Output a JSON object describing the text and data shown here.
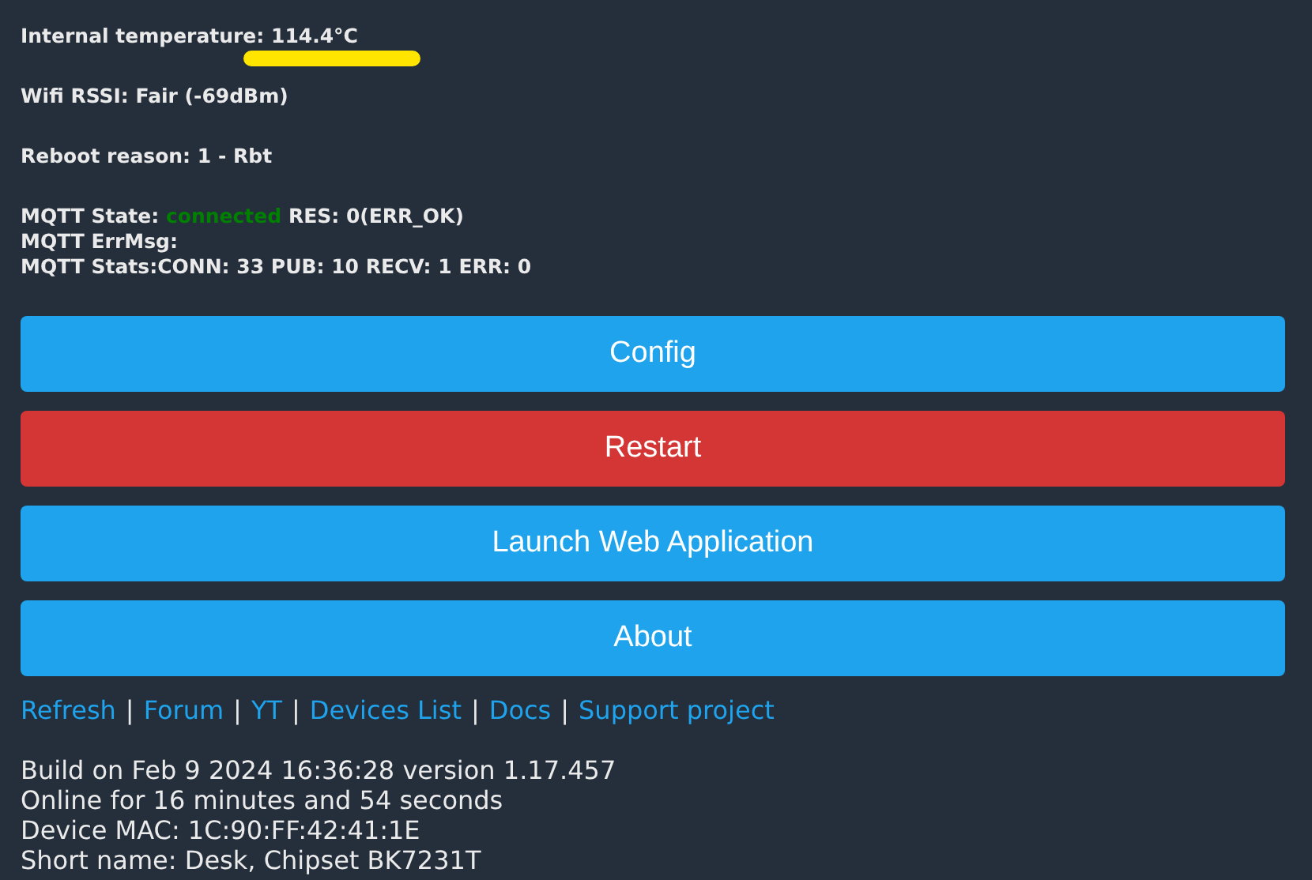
{
  "status": {
    "temperature": {
      "text": "Internal temperature: 114.4°C",
      "underlined": true
    },
    "wifi": "Wifi RSSI: Fair (-69dBm)",
    "reboot": "Reboot reason: 1 - Rbt",
    "mqtt": {
      "state_label": "MQTT State:",
      "state": "connected",
      "connected": true,
      "result": "RES: 0(ERR_OK)",
      "errmsg": "MQTT ErrMsg:",
      "stats": "MQTT Stats:CONN: 33 PUB: 10 RECV: 1 ERR: 0"
    }
  },
  "buttons": [
    {
      "label": "Config",
      "kind": "normal"
    },
    {
      "label": "Restart",
      "kind": "danger"
    },
    {
      "label": "Launch Web Application",
      "kind": "normal"
    },
    {
      "label": "About",
      "kind": "normal"
    }
  ],
  "links": [
    {
      "label": "Refresh",
      "separator": "|"
    },
    {
      "label": "Forum",
      "separator": "|"
    },
    {
      "label": "YT",
      "separator": "|"
    },
    {
      "label": "Devices List",
      "separator": "|"
    },
    {
      "label": "Docs",
      "separator": "|"
    },
    {
      "label": "Support project"
    }
  ],
  "info": [
    "Build on Feb 9 2024 16:36:28 version 1.17.457",
    "Online for 16 minutes and 54 seconds",
    "Device MAC: 1C:90:FF:42:41:1E",
    "Short name: Desk, Chipset BK7231T"
  ]
}
